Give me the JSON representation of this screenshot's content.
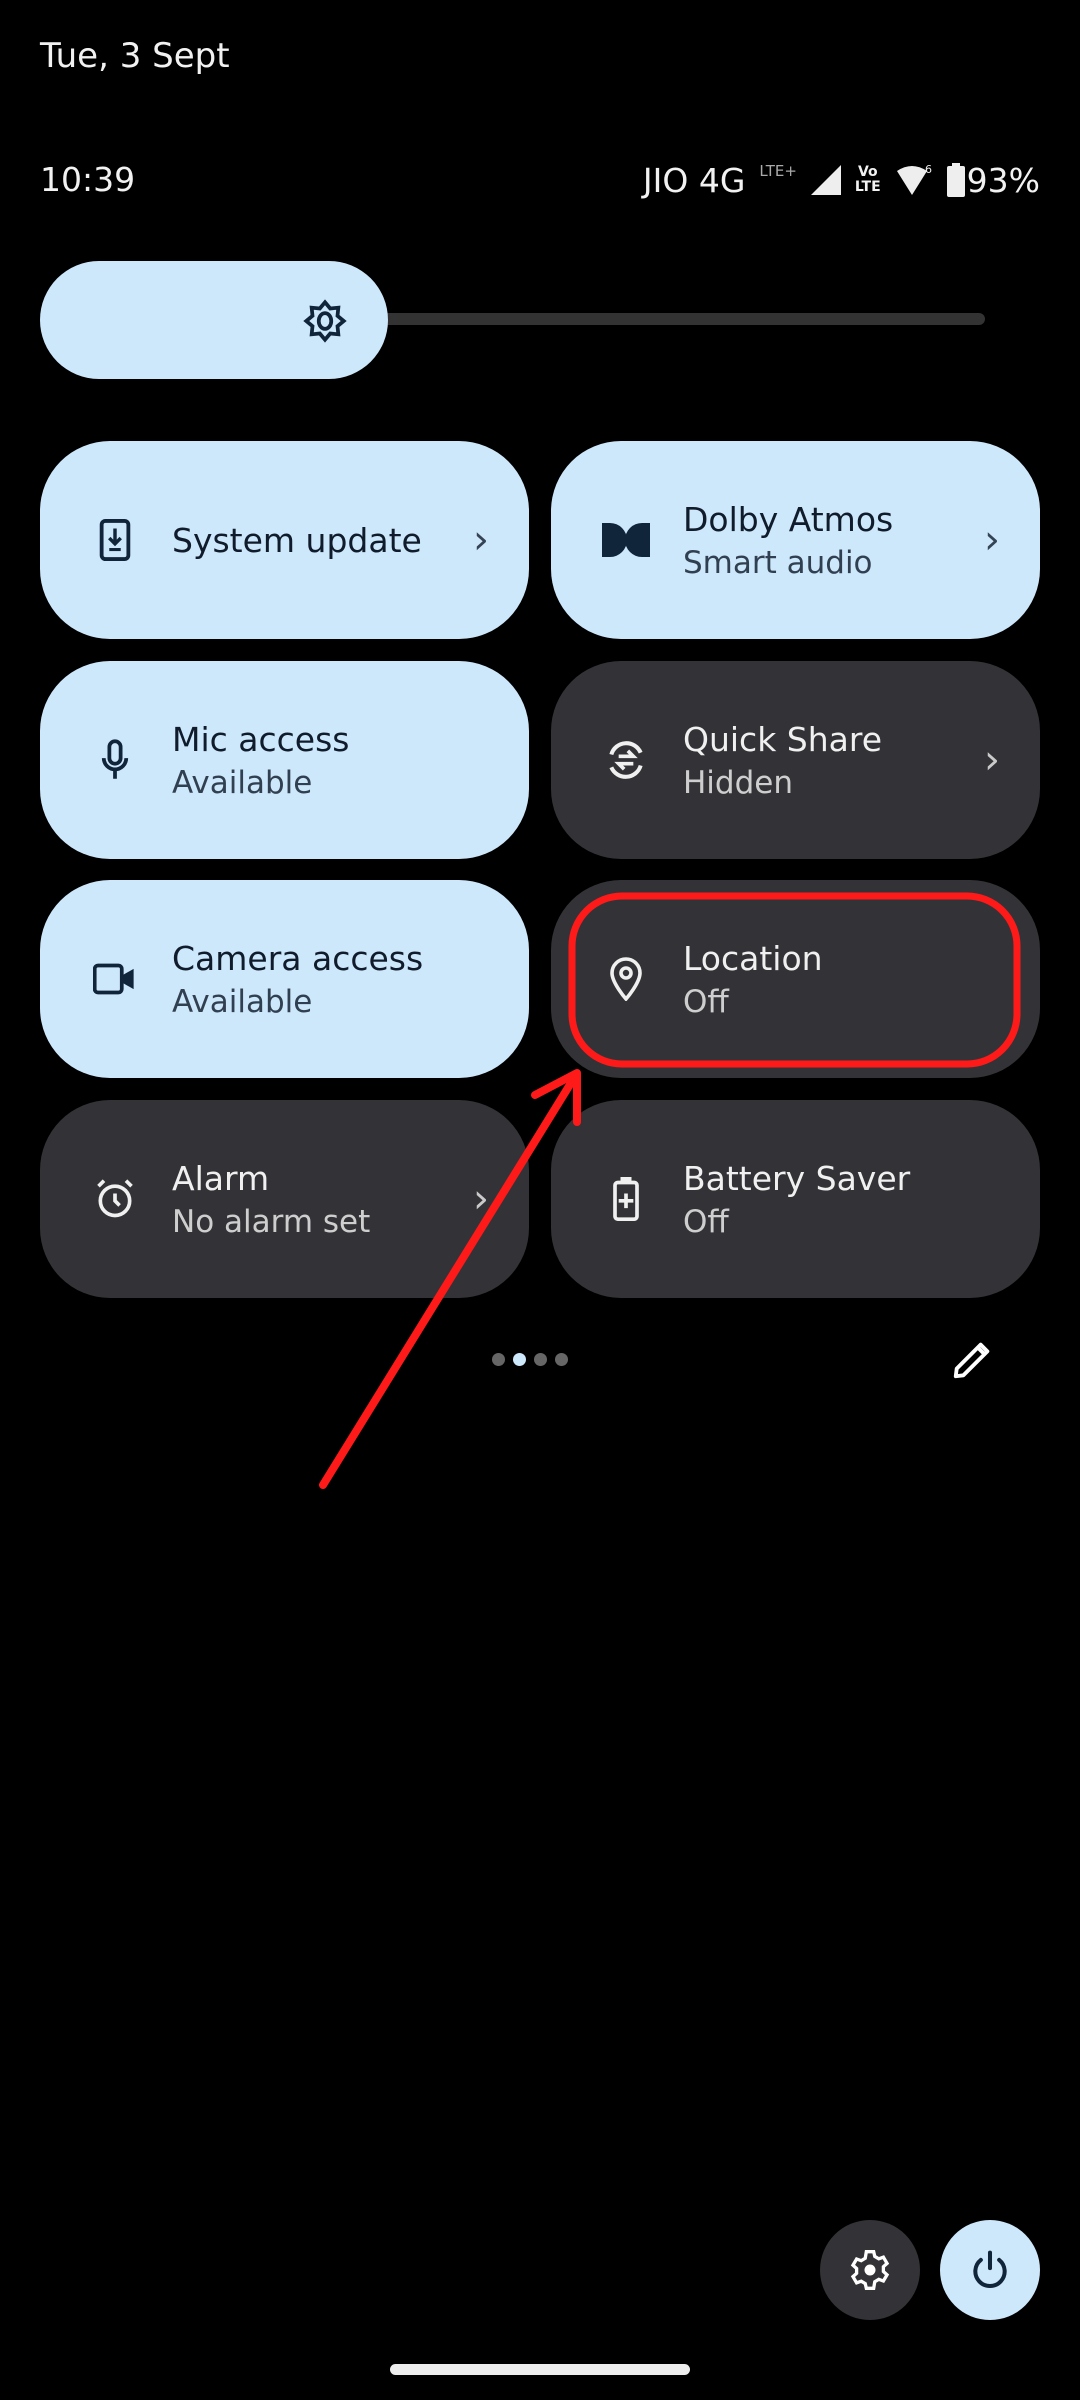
{
  "status_bar": {
    "date": "Tue, 3 Sept",
    "time": "10:39",
    "carrier": "JIO 4G",
    "network_badge": "LTE+",
    "volte_top": "Vo",
    "volte_bottom": "LTE",
    "wifi_badge": "6",
    "battery": "93%"
  },
  "brightness": {
    "level_percent": 35
  },
  "tiles": [
    {
      "title": "System update",
      "subtitle": "",
      "icon": "system-update-icon",
      "state": "on",
      "has_chevron": true
    },
    {
      "title": "Dolby Atmos",
      "subtitle": "Smart audio",
      "icon": "dolby-icon",
      "state": "on",
      "has_chevron": true
    },
    {
      "title": "Mic access",
      "subtitle": "Available",
      "icon": "microphone-icon",
      "state": "on",
      "has_chevron": false
    },
    {
      "title": "Quick Share",
      "subtitle": "Hidden",
      "icon": "quick-share-icon",
      "state": "off",
      "has_chevron": true
    },
    {
      "title": "Camera access",
      "subtitle": "Available",
      "icon": "camera-icon",
      "state": "on",
      "has_chevron": false
    },
    {
      "title": "Location",
      "subtitle": "Off",
      "icon": "location-pin-icon",
      "state": "off",
      "has_chevron": false
    },
    {
      "title": "Alarm",
      "subtitle": "No alarm set",
      "icon": "alarm-clock-icon",
      "state": "off",
      "has_chevron": true
    },
    {
      "title": "Battery Saver",
      "subtitle": "Off",
      "icon": "battery-saver-icon",
      "state": "off",
      "has_chevron": false
    }
  ],
  "chevron": "›",
  "pagination": {
    "pages": 4,
    "current": 2
  },
  "annotation": {
    "highlighted_tile": "Location",
    "color": "#ff1a1a"
  },
  "colors": {
    "tile_on": "#cde7fb",
    "tile_off": "#333337",
    "background": "#000000"
  }
}
